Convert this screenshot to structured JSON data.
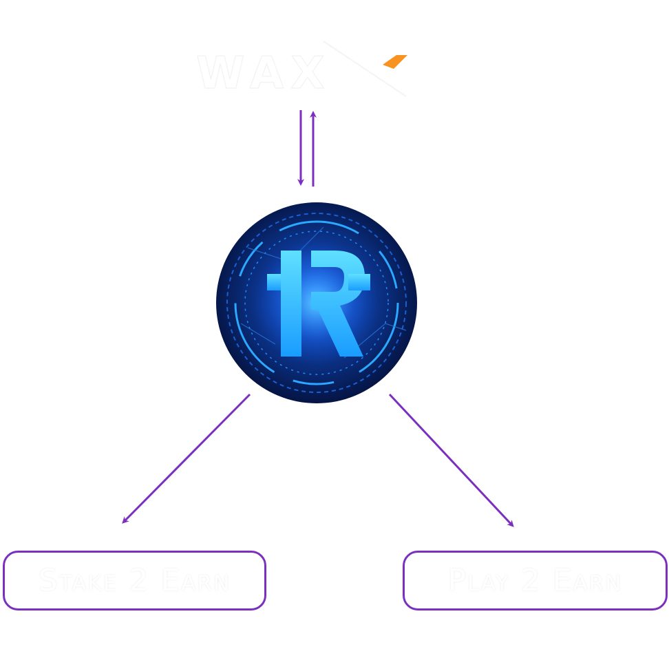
{
  "colors": {
    "arrow": "#7b2fbf",
    "box_border": "#7b2fbf",
    "coin_dark": "#061a4a",
    "coin_glow": "#1d8fff",
    "letter": "#2ec9ff",
    "logo_accent": "#f7931e"
  },
  "top_logo": {
    "icon": "wax-logo-icon",
    "text": "WAX"
  },
  "center_logo": {
    "icon": "r-coin-icon",
    "letter": "R"
  },
  "nodes": {
    "stake": {
      "label": "Stake 2 Earn"
    },
    "play": {
      "label": "Play 2 Earn"
    }
  }
}
